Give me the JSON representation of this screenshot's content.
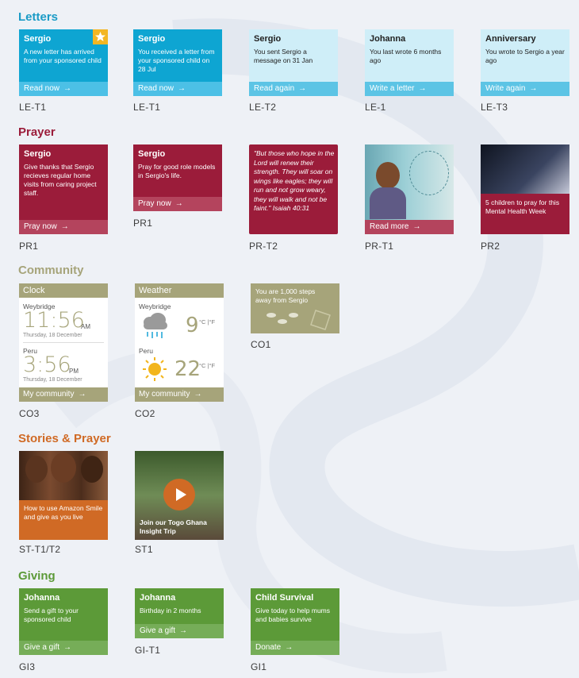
{
  "sections": {
    "letters": "Letters",
    "prayer": "Prayer",
    "community": "Community",
    "stories": "Stories & Prayer",
    "giving": "Giving"
  },
  "colors": {
    "letters": "#1a9bc6",
    "prayer": "#9b1c3a",
    "community": "#a6a47a",
    "stories": "#d06a25",
    "giving": "#5c9a38"
  },
  "letters": [
    {
      "title": "Sergio",
      "message": "A new letter has arrived from your sponsored child",
      "action": "Read now",
      "code": "LE-T1",
      "badge": "star-icon"
    },
    {
      "title": "Sergio",
      "message": "You received a letter from your sponsored child on 28 Jul",
      "action": "Read now",
      "code": "LE-T1"
    },
    {
      "title": "Sergio",
      "message": "You sent Sergio a message on 31 Jan",
      "action": "Read again",
      "code": "LE-T2"
    },
    {
      "title": "Johanna",
      "message": "You last wrote 6 months ago",
      "action": "Write a letter",
      "code": "LE-1"
    },
    {
      "title": "Anniversary",
      "message": "You wrote to Sergio a year ago",
      "action": "Write again",
      "code": "LE-T3"
    }
  ],
  "prayer": [
    {
      "title": "Sergio",
      "message": "Give thanks that Sergio recieves regular home visits from caring project staff.",
      "action": "Pray now",
      "code": "PR1"
    },
    {
      "title": "Sergio",
      "message": "Pray for good role models in Sergio's life.",
      "action": "Pray now",
      "code": "PR1"
    },
    {
      "quote": "\"But those who hope in the Lord will renew their strength. They will soar on wings like eagles; they will run and not grow weary, they will walk and not be faint.\" Isaiah 40:31",
      "code": "PR-T2"
    },
    {
      "action": "Read more",
      "code": "PR-T1"
    },
    {
      "message": "5 children to pray for this Mental Health Week",
      "code": "PR2"
    }
  ],
  "community": {
    "clock": {
      "header": "Clock",
      "city1": "Weybridge",
      "time1": "11:56",
      "ampm1": "AM",
      "date1": "Thursday, 18 December",
      "city2": "Peru",
      "time2": "3:56",
      "ampm2": "PM",
      "date2": "Thursday, 18 December",
      "action": "My community",
      "code": "CO3"
    },
    "weather": {
      "header": "Weather",
      "city1": "Weybridge",
      "temp1": "9",
      "city2": "Peru",
      "temp2": "22",
      "units": "°C |°F",
      "action": "My community",
      "code": "CO2"
    },
    "steps": {
      "message": "You are 1,000 steps away from Sergio",
      "code": "CO1"
    }
  },
  "stories": [
    {
      "message": "How to use Amazon Smile and give as you live",
      "code": "ST-T1/T2"
    },
    {
      "message": "Join our Togo Ghana Insight Trip",
      "code": "ST1"
    }
  ],
  "giving": [
    {
      "title": "Johanna",
      "message": "Send a gift to your sponsored child",
      "action": "Give a gift",
      "code": "GI3"
    },
    {
      "title": "Johanna",
      "message": "Birthday in 2 months",
      "action": "Give a gift",
      "code": "GI-T1"
    },
    {
      "title": "Child Survival",
      "message": "Give today to help mums and babies survive",
      "action": "Donate",
      "code": "GI1"
    }
  ]
}
